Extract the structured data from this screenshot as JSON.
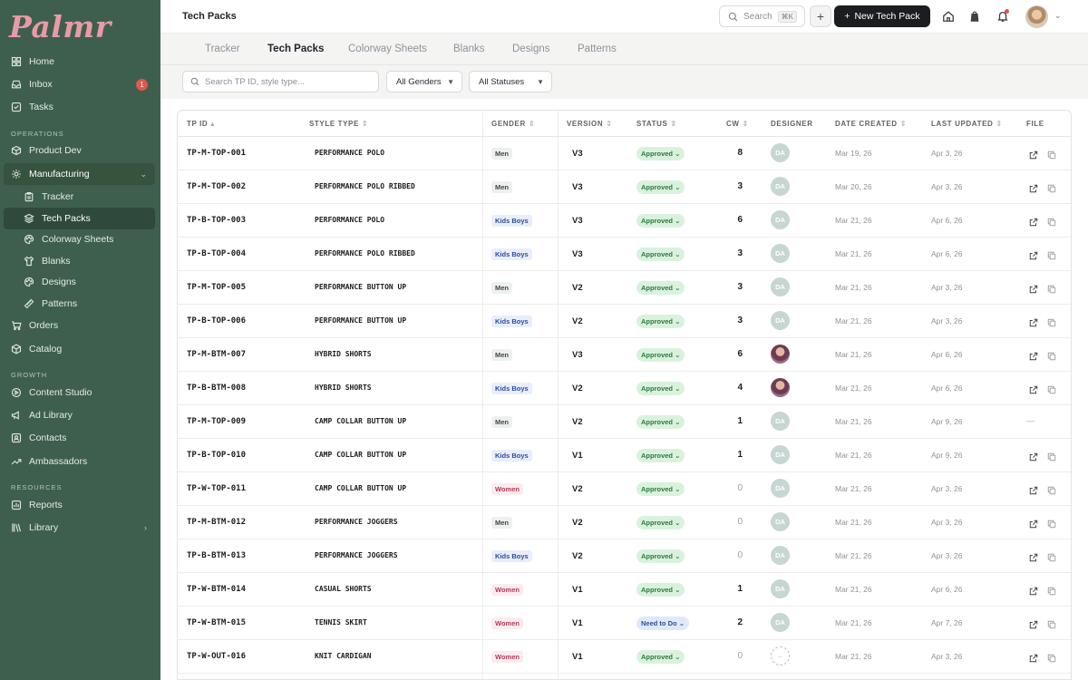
{
  "app": {
    "logo": "Palmr"
  },
  "sidebar": {
    "items_top": [
      {
        "label": "Home",
        "icon": "grid-icon"
      },
      {
        "label": "Inbox",
        "icon": "inbox-icon",
        "badge": "1"
      },
      {
        "label": "Tasks",
        "icon": "check-square-icon"
      }
    ],
    "operations_label": "OPERATIONS",
    "operations": [
      {
        "label": "Product Dev",
        "icon": "box-icon"
      },
      {
        "label": "Manufacturing",
        "icon": "gear-icon"
      }
    ],
    "manufacturing_sub": [
      {
        "label": "Tracker",
        "icon": "clipboard-icon"
      },
      {
        "label": "Tech Packs",
        "icon": "layers-icon"
      },
      {
        "label": "Colorway Sheets",
        "icon": "palette-icon"
      },
      {
        "label": "Blanks",
        "icon": "shirt-icon"
      },
      {
        "label": "Designs",
        "icon": "palette-icon"
      },
      {
        "label": "Patterns",
        "icon": "ruler-icon"
      }
    ],
    "operations_more": [
      {
        "label": "Orders",
        "icon": "cart-icon"
      },
      {
        "label": "Catalog",
        "icon": "cube-icon"
      }
    ],
    "growth_label": "GROWTH",
    "growth": [
      {
        "label": "Content Studio",
        "icon": "play-icon"
      },
      {
        "label": "Ad Library",
        "icon": "megaphone-icon"
      },
      {
        "label": "Contacts",
        "icon": "contact-icon"
      },
      {
        "label": "Ambassadors",
        "icon": "trend-icon"
      }
    ],
    "resources_label": "RESOURCES",
    "resources": [
      {
        "label": "Reports",
        "icon": "chart-icon"
      },
      {
        "label": "Library",
        "icon": "library-icon"
      }
    ]
  },
  "topbar": {
    "title": "Tech Packs",
    "search_label": "Search",
    "search_shortcut": "⌘K",
    "new_button": "New Tech Pack"
  },
  "tabs": [
    "Tracker",
    "Tech Packs",
    "Colorway Sheets",
    "Blanks",
    "Designs",
    "Patterns"
  ],
  "active_tab": "Tech Packs",
  "filters": {
    "search_placeholder": "Search TP ID, style type...",
    "gender": "All Genders",
    "status": "All Statuses"
  },
  "table": {
    "columns": [
      "TP ID",
      "STYLE TYPE",
      "GENDER",
      "VERSION",
      "STATUS",
      "CW",
      "DESIGNER",
      "DATE CREATED",
      "LAST UPDATED",
      "FILE"
    ],
    "rows": [
      {
        "id": "TP-M-TOP-001",
        "style": "PERFORMANCE POLO",
        "gender": "Men",
        "version": "V3",
        "status": "Approved",
        "cw": "8",
        "designer": "DA",
        "created": "Mar 19, 26",
        "updated": "Apr 3, 26",
        "file": true
      },
      {
        "id": "TP-M-TOP-002",
        "style": "PERFORMANCE POLO RIBBED",
        "gender": "Men",
        "version": "V3",
        "status": "Approved",
        "cw": "3",
        "designer": "DA",
        "created": "Mar 20, 26",
        "updated": "Apr 3, 26",
        "file": true
      },
      {
        "id": "TP-B-TOP-003",
        "style": "PERFORMANCE POLO",
        "gender": "Kids Boys",
        "version": "V3",
        "status": "Approved",
        "cw": "6",
        "designer": "DA",
        "created": "Mar 21, 26",
        "updated": "Apr 6, 26",
        "file": true
      },
      {
        "id": "TP-B-TOP-004",
        "style": "PERFORMANCE POLO RIBBED",
        "gender": "Kids Boys",
        "version": "V3",
        "status": "Approved",
        "cw": "3",
        "designer": "DA",
        "created": "Mar 21, 26",
        "updated": "Apr 6, 26",
        "file": true
      },
      {
        "id": "TP-M-TOP-005",
        "style": "PERFORMANCE BUTTON UP",
        "gender": "Men",
        "version": "V2",
        "status": "Approved",
        "cw": "3",
        "designer": "DA",
        "created": "Mar 21, 26",
        "updated": "Apr 3, 26",
        "file": true
      },
      {
        "id": "TP-B-TOP-006",
        "style": "PERFORMANCE BUTTON UP",
        "gender": "Kids Boys",
        "version": "V2",
        "status": "Approved",
        "cw": "3",
        "designer": "DA",
        "created": "Mar 21, 26",
        "updated": "Apr 3, 26",
        "file": true
      },
      {
        "id": "TP-M-BTM-007",
        "style": "HYBRID SHORTS",
        "gender": "Men",
        "version": "V3",
        "status": "Approved",
        "cw": "6",
        "designer": "photo",
        "created": "Mar 21, 26",
        "updated": "Apr 6, 26",
        "file": true
      },
      {
        "id": "TP-B-BTM-008",
        "style": "HYBRID SHORTS",
        "gender": "Kids Boys",
        "version": "V2",
        "status": "Approved",
        "cw": "4",
        "designer": "photo",
        "created": "Mar 21, 26",
        "updated": "Apr 6, 26",
        "file": true
      },
      {
        "id": "TP-M-TOP-009",
        "style": "CAMP COLLAR BUTTON UP",
        "gender": "Men",
        "version": "V2",
        "status": "Approved",
        "cw": "1",
        "designer": "DA",
        "created": "Mar 21, 26",
        "updated": "Apr 9, 26",
        "file": false
      },
      {
        "id": "TP-B-TOP-010",
        "style": "CAMP COLLAR BUTTON UP",
        "gender": "Kids Boys",
        "version": "V1",
        "status": "Approved",
        "cw": "1",
        "designer": "DA",
        "created": "Mar 21, 26",
        "updated": "Apr 9, 26",
        "file": true
      },
      {
        "id": "TP-W-TOP-011",
        "style": "CAMP COLLAR BUTTON UP",
        "gender": "Women",
        "version": "V2",
        "status": "Approved",
        "cw": "0",
        "designer": "DA",
        "created": "Mar 21, 26",
        "updated": "Apr 3, 26",
        "file": true
      },
      {
        "id": "TP-M-BTM-012",
        "style": "PERFORMANCE JOGGERS",
        "gender": "Men",
        "version": "V2",
        "status": "Approved",
        "cw": "0",
        "designer": "DA",
        "created": "Mar 21, 26",
        "updated": "Apr 3, 26",
        "file": true
      },
      {
        "id": "TP-B-BTM-013",
        "style": "PERFORMANCE JOGGERS",
        "gender": "Kids Boys",
        "version": "V2",
        "status": "Approved",
        "cw": "0",
        "designer": "DA",
        "created": "Mar 21, 26",
        "updated": "Apr 3, 26",
        "file": true
      },
      {
        "id": "TP-W-BTM-014",
        "style": "CASUAL SHORTS",
        "gender": "Women",
        "version": "V1",
        "status": "Approved",
        "cw": "1",
        "designer": "DA",
        "created": "Mar 21, 26",
        "updated": "Apr 6, 26",
        "file": true
      },
      {
        "id": "TP-W-BTM-015",
        "style": "TENNIS SKIRT",
        "gender": "Women",
        "version": "V1",
        "status": "Need to Do",
        "cw": "2",
        "designer": "DA",
        "created": "Mar 21, 26",
        "updated": "Apr 7, 26",
        "file": true
      },
      {
        "id": "TP-W-OUT-016",
        "style": "KNIT CARDIGAN",
        "gender": "Women",
        "version": "V1",
        "status": "Approved",
        "cw": "0",
        "designer": "empty",
        "created": "Mar 21, 26",
        "updated": "Apr 3, 26",
        "file": true
      }
    ]
  },
  "colors": {
    "sidebar_bg": "#3f5f4e",
    "logo": "#e99aa8",
    "approved": "#2b7a3d",
    "need_to_do": "#2b4f9c",
    "badge": "#e0554d"
  }
}
